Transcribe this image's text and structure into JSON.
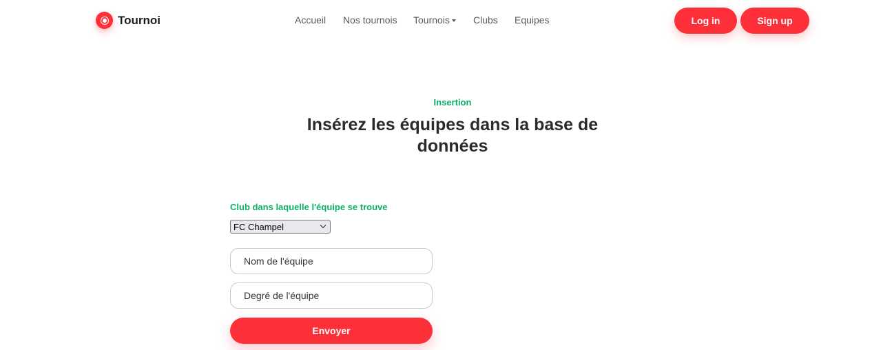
{
  "brand": {
    "name": "Tournoi",
    "icon": "soccer-ball-icon",
    "accent": "#fd3039"
  },
  "nav": {
    "items": [
      {
        "label": "Accueil"
      },
      {
        "label": "Nos tournois"
      },
      {
        "label": "Tournois",
        "dropdown": true
      },
      {
        "label": "Clubs"
      },
      {
        "label": "Equipes"
      }
    ]
  },
  "auth": {
    "login_label": "Log in",
    "signup_label": "Sign up"
  },
  "section": {
    "kicker": "Insertion",
    "title": "Insérez les équipes dans la base de données",
    "kicker_color": "#0ab067"
  },
  "form": {
    "club_label": "Club dans laquelle l'équipe se trouve",
    "club_selected": "FC Champel",
    "team_name_placeholder": "Nom de l'équipe",
    "team_degree_placeholder": "Degré de l'équipe",
    "submit_label": "Envoyer"
  }
}
